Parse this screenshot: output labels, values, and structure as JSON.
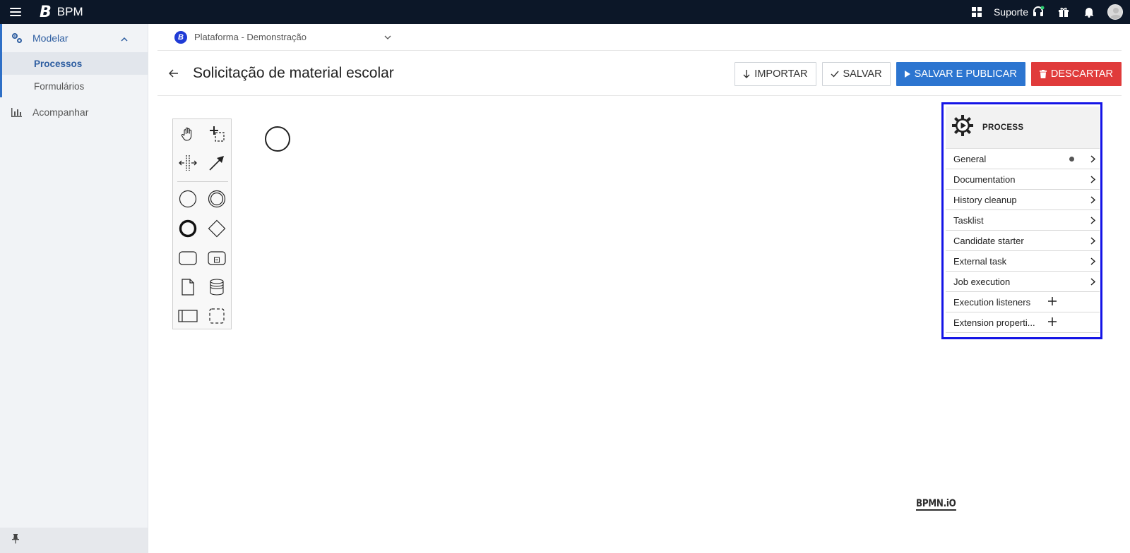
{
  "topbar": {
    "logo": "B",
    "app_name": "BPM",
    "support_label": "Suporte",
    "icons": [
      "menu-icon",
      "grid-icon",
      "headset-icon",
      "gift-icon",
      "bell-icon",
      "avatar"
    ]
  },
  "sidebar": {
    "modelar": {
      "label": "Modelar",
      "icon": "gears-icon",
      "expanded": true
    },
    "subitems": [
      {
        "label": "Processos",
        "selected": true
      },
      {
        "label": "Formulários",
        "selected": false
      }
    ],
    "acompanhar": {
      "label": "Acompanhar",
      "icon": "bar-chart-icon"
    },
    "pin_icon": "pin-icon"
  },
  "platform": {
    "logo": "B",
    "name": "Plataforma - Demonstração"
  },
  "header": {
    "title": "Solicitação de material escolar",
    "buttons": {
      "import": "IMPORTAR",
      "save": "SALVAR",
      "save_publish": "SALVAR E PUBLICAR",
      "discard": "DESCARTAR"
    }
  },
  "palette": {
    "tools": [
      "hand-tool-icon",
      "lasso-tool-icon",
      "space-tool-icon",
      "connect-tool-icon"
    ],
    "shapes": [
      "start-event-icon",
      "intermediate-event-icon",
      "end-event-icon",
      "gateway-icon",
      "task-icon",
      "subprocess-icon",
      "data-object-icon",
      "data-store-icon",
      "pool-icon",
      "group-icon"
    ]
  },
  "properties": {
    "header_title": "PROCESS",
    "groups": [
      {
        "label": "General",
        "kind": "chevron",
        "has_dot": true
      },
      {
        "label": "Documentation",
        "kind": "chevron",
        "has_dot": false
      },
      {
        "label": "History cleanup",
        "kind": "chevron",
        "has_dot": false
      },
      {
        "label": "Tasklist",
        "kind": "chevron",
        "has_dot": false
      },
      {
        "label": "Candidate starter",
        "kind": "chevron",
        "has_dot": false
      },
      {
        "label": "External task",
        "kind": "chevron",
        "has_dot": false
      },
      {
        "label": "Job execution",
        "kind": "chevron",
        "has_dot": false
      },
      {
        "label": "Execution listeners",
        "kind": "plus",
        "has_dot": false
      },
      {
        "label": "Extension properti...",
        "kind": "plus",
        "has_dot": false
      }
    ]
  },
  "watermark": "BPMN.iO",
  "colors": {
    "topbar_bg": "#0c1728",
    "accent": "#2c75d0",
    "danger": "#e03b3b",
    "highlight_border": "#1414e6"
  }
}
